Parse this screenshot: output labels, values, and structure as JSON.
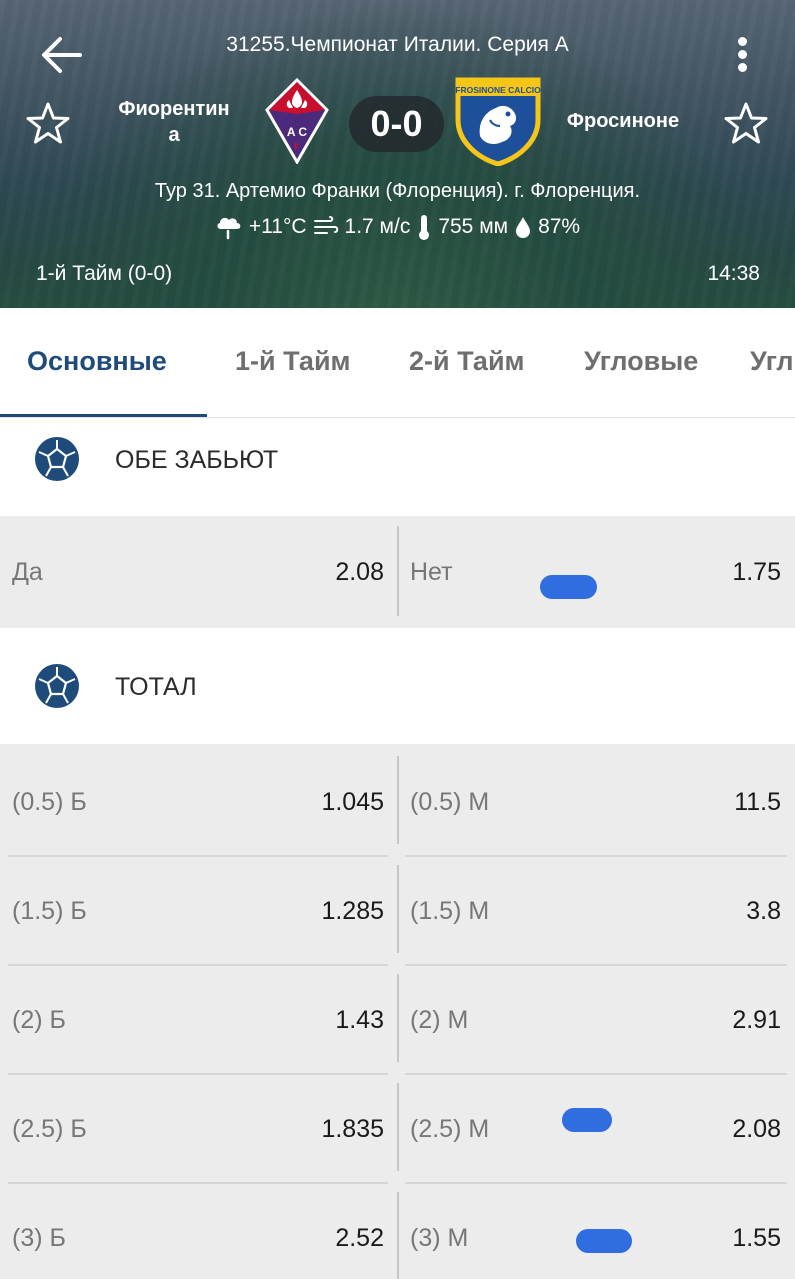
{
  "header": {
    "league": "31255.Чемпионат Италии. Серия А",
    "home_team": "Фиорентин\nа",
    "home_team_line1": "Фиорентин",
    "home_team_line2": "а",
    "away_team": "Фросиноне",
    "score": "0-0",
    "venue": "Тур 31. Артемио Франки (Флоренция). г. Флоренция.",
    "weather": {
      "temperature": "+11°C",
      "wind": "1.7 м/с",
      "pressure": "755 мм",
      "humidity": "87%"
    },
    "period": "1-й  Тайм (0-0)",
    "timer": "14:38",
    "icons": [
      "back-arrow-icon",
      "more-vert-icon",
      "star-outline-icon",
      "cloud-rain-icon",
      "wind-icon",
      "thermometer-icon",
      "drop-icon"
    ]
  },
  "tabs": [
    {
      "label": "Основные",
      "active": true
    },
    {
      "label": "1-й  Тайм",
      "active": false
    },
    {
      "label": "2-й  Тайм",
      "active": false
    },
    {
      "label": "Угловые",
      "active": false
    },
    {
      "label": "Угл",
      "active": false
    }
  ],
  "both_score": {
    "title": "ОБЕ ЗАБЬЮТ",
    "left": {
      "label": "Да",
      "value": "2.08"
    },
    "right": {
      "label": "Нет",
      "value": "1.75"
    }
  },
  "total": {
    "title": "ТОТАЛ",
    "rows": [
      {
        "left_label": "(0.5) Б",
        "left_value": "1.045",
        "right_label": "(0.5) М",
        "right_value": "11.5"
      },
      {
        "left_label": "(1.5) Б",
        "left_value": "1.285",
        "right_label": "(1.5) М",
        "right_value": "3.8"
      },
      {
        "left_label": "(2) Б",
        "left_value": "1.43",
        "right_label": "(2) М",
        "right_value": "2.91"
      },
      {
        "left_label": "(2.5) Б",
        "left_value": "1.835",
        "right_label": "(2.5) М",
        "right_value": "2.08"
      },
      {
        "left_label": "(3) Б",
        "left_value": "2.52",
        "right_label": "(3) М",
        "right_value": "1.55"
      }
    ]
  },
  "colors": {
    "accent": "#1e4b7a",
    "odds_background": "#ececec",
    "marker": "#2f6de0"
  }
}
